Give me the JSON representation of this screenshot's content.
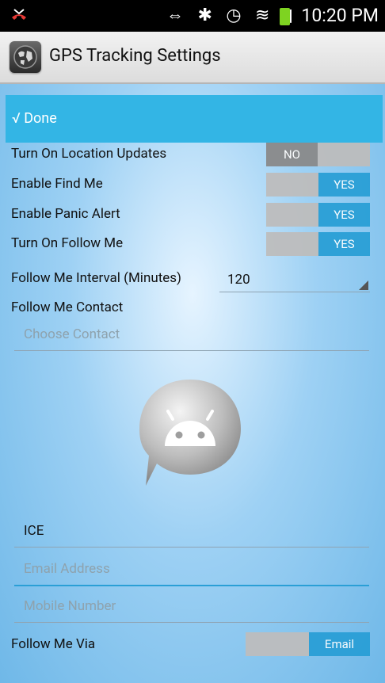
{
  "status": {
    "icons": "⇔ ✱ ◷ ≋ ▮",
    "time": "10:20 PM",
    "battery_color": "#7ed321"
  },
  "header": {
    "title": "GPS Tracking Settings",
    "app_icon": "globe-icon"
  },
  "done": {
    "label": "√ Done",
    "color": "#33b5e5"
  },
  "settings": [
    {
      "label": "Turn On Location Updates",
      "value": "NO"
    },
    {
      "label": "Enable Find Me",
      "value": "YES"
    },
    {
      "label": "Enable Panic Alert",
      "value": "YES"
    },
    {
      "label": "Turn On Follow Me",
      "value": "YES"
    }
  ],
  "interval": {
    "label": "Follow Me Interval (Minutes)",
    "value": "120"
  },
  "contact": {
    "label": "Follow Me Contact",
    "placeholder": "Choose Contact",
    "avatar": "android-contact-avatar"
  },
  "ice": {
    "value": "ICE"
  },
  "email": {
    "placeholder": "Email Address"
  },
  "mobile": {
    "placeholder": "Mobile Number"
  },
  "via": {
    "label": "Follow Me Via",
    "value": "Email"
  },
  "colors": {
    "accent": "#2a9fd6",
    "off": "#8a8a8a"
  }
}
